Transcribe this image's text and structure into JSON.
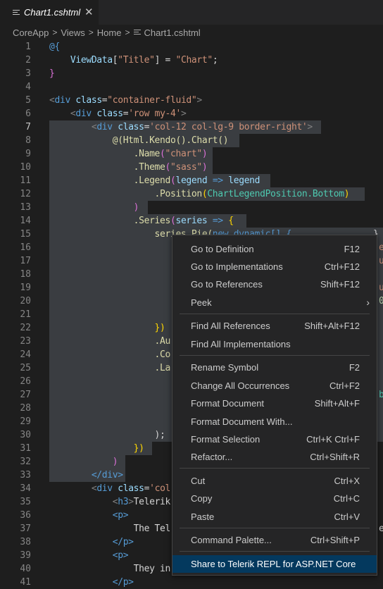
{
  "tab": {
    "filename": "Chart1.cshtml",
    "close": "✕"
  },
  "breadcrumb": [
    "CoreApp",
    "Views",
    "Home",
    "Chart1.cshtml"
  ],
  "editor": {
    "line_numbers": [
      "1",
      "2",
      "3",
      "4",
      "5",
      "6",
      "7",
      "8",
      "9",
      "10",
      "11",
      "12",
      "13",
      "14",
      "15",
      "16",
      "17",
      "18",
      "19",
      "20",
      "21",
      "22",
      "23",
      "24",
      "25",
      "26",
      "27",
      "28",
      "29",
      "30",
      "31",
      "32",
      "33",
      "34",
      "35",
      "36",
      "37",
      "38",
      "39",
      "40",
      "41"
    ],
    "active_line": "7",
    "code": {
      "l1_at": "@{",
      "l2_viewdata": "ViewData",
      "l2_key": "\"Title\"",
      "l2_eq": " = ",
      "l2_val": "\"Chart\"",
      "l2_end": ";",
      "l3": "}",
      "l5_tag": "div",
      "l5_attr": "class",
      "l5_val": "\"container-fluid\"",
      "l6_tag": "div",
      "l6_attr": "class",
      "l6_val": "'row my-4'",
      "l7_tag": "div",
      "l7_attr": "class",
      "l7_val": "'col-12 col-lg-9 border-right'",
      "l8": "@(Html.Kendo().Chart()",
      "l9_fn": ".Name",
      "l9_arg": "\"chart\"",
      "l10_fn": ".Theme",
      "l10_arg": "\"sass\"",
      "l11_fn": ".Legend",
      "l11_p": "legend",
      "l11_arrow": " => ",
      "l11_q": "legend",
      "l12_fn": ".Position",
      "l12_arg": "ChartLegendPosition.Bottom",
      "l13": ")",
      "l14_fn": ".Series",
      "l14_p": "series",
      "l14_arrow": " => ",
      "l14_brace": "{",
      "l15_a": "series.Pie(",
      "l15_b": "new dynamic[] {",
      "l22": "})",
      "l23": ".Au",
      "l24": ".Co",
      "l25": ".La",
      "l30": ");",
      "l31": "})",
      "l32": ")",
      "l33": "</div>",
      "l34_tag": "div",
      "l34_attr": "class",
      "l34_val": "'col",
      "l35_tag": "h3",
      "l35_text": "Telerik",
      "l36": "<p>",
      "l37_text": "The Tel",
      "l38": "</p>",
      "l39": "<p>",
      "l40_text": "They in",
      "l41": "</p>"
    },
    "right_edge": {
      "r15": "}",
      "r16": "e",
      "r17": "u",
      "r19": "u",
      "r20": "0",
      "r26": "b",
      "r37": "e"
    }
  },
  "context_menu": {
    "items": [
      {
        "label": "Go to Definition",
        "shortcut": "F12"
      },
      {
        "label": "Go to Implementations",
        "shortcut": "Ctrl+F12"
      },
      {
        "label": "Go to References",
        "shortcut": "Shift+F12"
      },
      {
        "label": "Peek",
        "shortcut": "",
        "submenu": "›"
      },
      {
        "label": "Find All References",
        "shortcut": "Shift+Alt+F12"
      },
      {
        "label": "Find All Implementations",
        "shortcut": ""
      },
      {
        "label": "Rename Symbol",
        "shortcut": "F2"
      },
      {
        "label": "Change All Occurrences",
        "shortcut": "Ctrl+F2"
      },
      {
        "label": "Format Document",
        "shortcut": "Shift+Alt+F"
      },
      {
        "label": "Format Document With...",
        "shortcut": ""
      },
      {
        "label": "Format Selection",
        "shortcut": "Ctrl+K Ctrl+F"
      },
      {
        "label": "Refactor...",
        "shortcut": "Ctrl+Shift+R"
      },
      {
        "label": "Cut",
        "shortcut": "Ctrl+X"
      },
      {
        "label": "Copy",
        "shortcut": "Ctrl+C"
      },
      {
        "label": "Paste",
        "shortcut": "Ctrl+V"
      },
      {
        "label": "Command Palette...",
        "shortcut": "Ctrl+Shift+P"
      },
      {
        "label": "Share to Telerik REPL for ASP.NET Core",
        "shortcut": ""
      }
    ]
  },
  "colors": {
    "background": "#1e1e1e",
    "menu_bg": "#252526",
    "menu_highlight": "#04395e",
    "selection": "#3a3d41",
    "keyword": "#569cd6",
    "string": "#ce9178"
  },
  "icons": {
    "tab": "file-lines-icon",
    "breadcrumb_file": "file-lines-icon",
    "submenu": "chevron-right-icon",
    "close": "close-icon"
  }
}
